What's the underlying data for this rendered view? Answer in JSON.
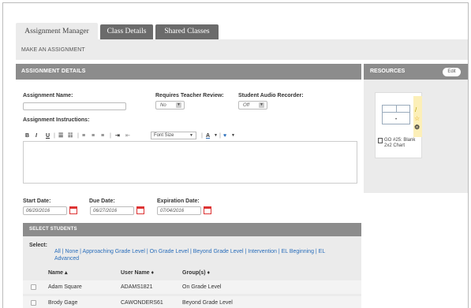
{
  "tabs": [
    {
      "label": "Assignment Manager",
      "active": true
    },
    {
      "label": "Class Details",
      "active": false
    },
    {
      "label": "Shared Classes",
      "active": false
    }
  ],
  "subheader": "MAKE AN ASSIGNMENT",
  "details": {
    "title": "ASSIGNMENT DETAILS",
    "name_label": "Assignment Name:",
    "name_value": "",
    "review_label": "Requires Teacher Review:",
    "review_value": "No",
    "audio_label": "Student Audio Recorder:",
    "audio_value": "Off",
    "instructions_label": "Assignment Instructions:",
    "toolbar": {
      "bold": "B",
      "italic": "I",
      "underline": "U",
      "font_size": "Font Size"
    }
  },
  "resources": {
    "title": "RESOURCES",
    "edit_label": "Edit",
    "items": [
      {
        "title": "GO #25: Blank 2x2 Chart"
      }
    ]
  },
  "dates": {
    "start_label": "Start Date:",
    "start_value": "06/20/2016",
    "due_label": "Due Date:",
    "due_value": "06/27/2016",
    "exp_label": "Expiration Date:",
    "exp_value": "07/04/2016"
  },
  "students": {
    "title": "SELECT STUDENTS",
    "select_label": "Select:",
    "filters_line1": "All | None | Approaching Grade Level | On Grade Level | Beyond Grade Level | Intervention | EL Beginning | EL",
    "filters_line2": "Advanced",
    "columns": {
      "name": "Name ▴",
      "user": "User Name ♦",
      "group": "Group(s) ♦"
    },
    "rows": [
      {
        "name": "Adam Square",
        "user": "ADAMS1821",
        "group": "On Grade Level"
      },
      {
        "name": "Brody Gage",
        "user": "CAWONDERS61",
        "group": "Beyond Grade Level"
      }
    ]
  }
}
